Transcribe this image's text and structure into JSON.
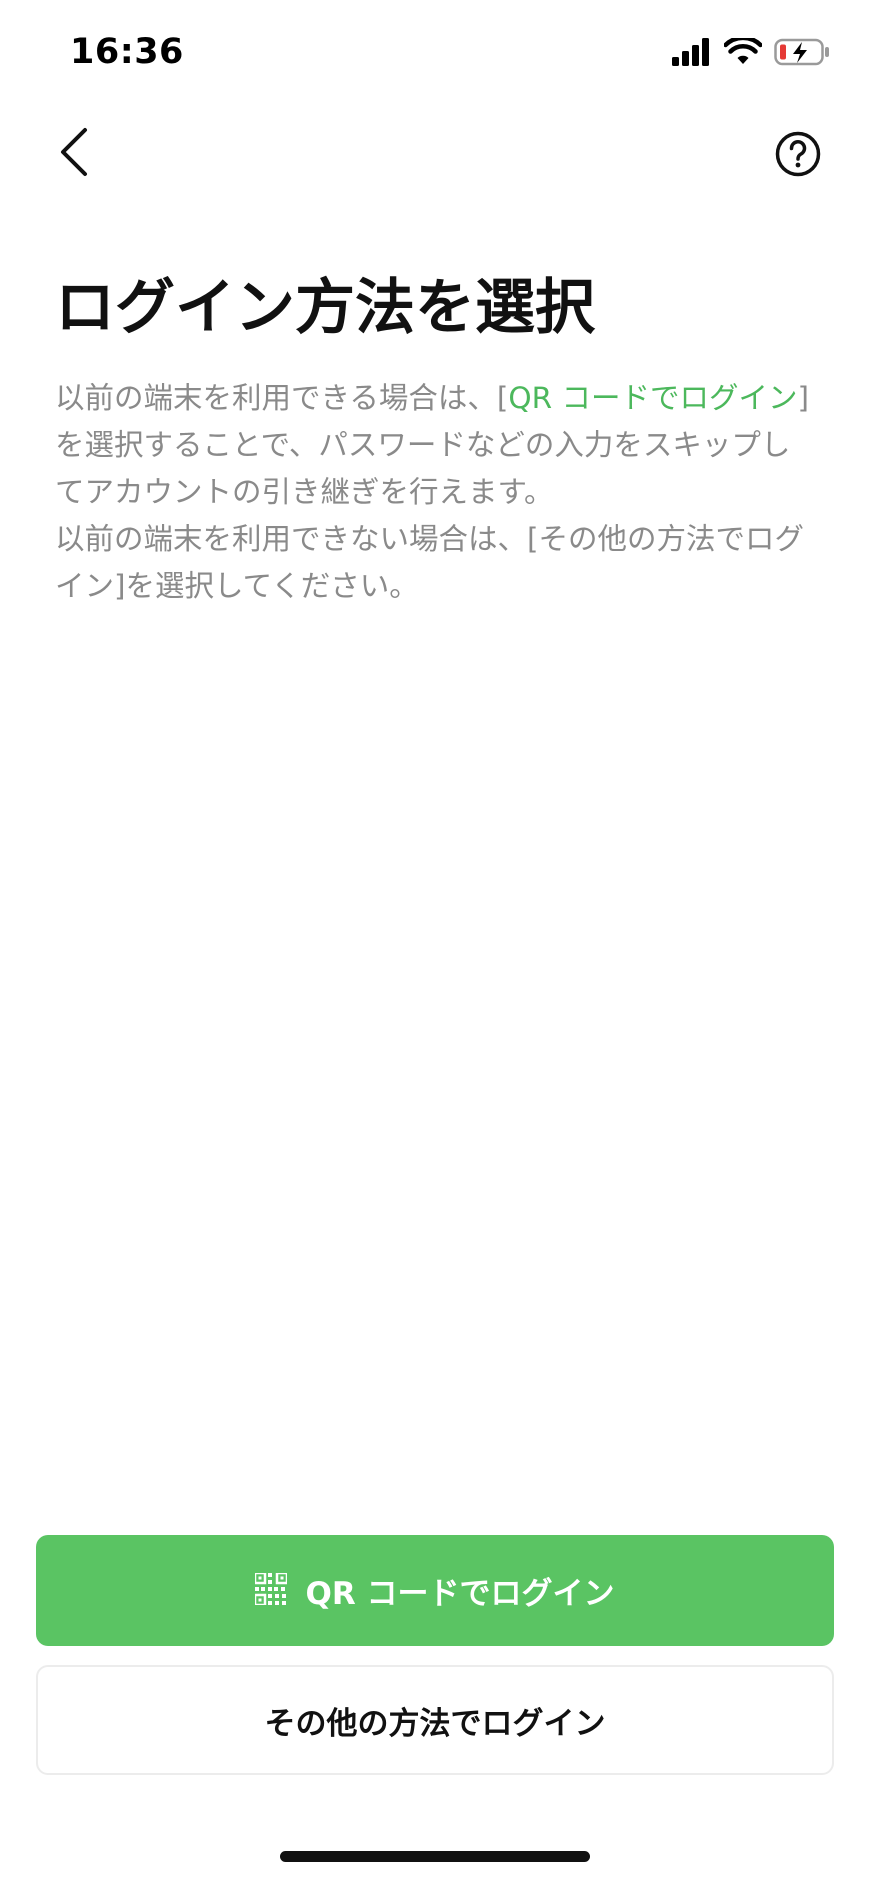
{
  "status_bar": {
    "time": "16:36",
    "signal_icon": "cellular-signal-icon",
    "wifi_icon": "wifi-icon",
    "battery_icon": "battery-charging-icon",
    "battery_low_color": "#e53935"
  },
  "nav": {
    "back_icon": "chevron-left-icon",
    "help_icon": "question-circle-icon"
  },
  "title": "ログイン方法を選択",
  "description": {
    "part1": "以前の端末を利用できる場合は、[",
    "link": "QR コードでログイン",
    "part2": "]を選択することで、パスワードなどの入力をスキップしてアカウントの引き継ぎを行えます。",
    "part3": "以前の端末を利用できない場合は、[その他の方法でログイン]を選択してください。"
  },
  "buttons": {
    "qr_login_label": "QR コードでログイン",
    "qr_icon": "qr-code-icon",
    "other_login_label": "その他の方法でログイン"
  },
  "colors": {
    "accent_green": "#5ac463",
    "link_green": "#4cb85c",
    "body_text": "#8a8a8a"
  }
}
